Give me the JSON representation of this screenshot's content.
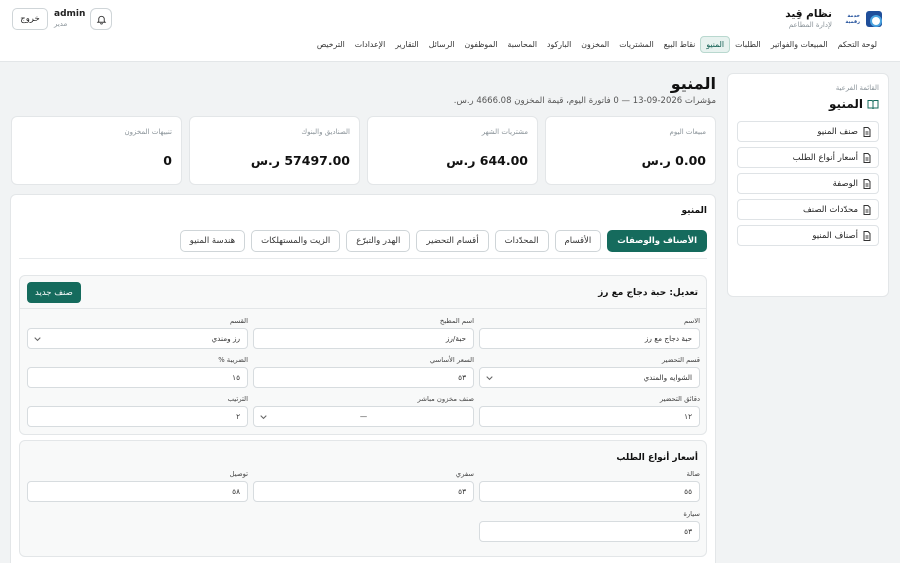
{
  "header": {
    "brand_name": "نظام قِيد",
    "brand_tagline": "لإدارة المطاعم",
    "brand_logo_text": "خدمة رقمية",
    "user_name": "admin",
    "user_role": "مدير",
    "logout_label": "خروج"
  },
  "nav": {
    "items": [
      "لوحة التحكم",
      "المبيعات والفواتير",
      "الطلبات",
      "المنيو",
      "نقاط البيع",
      "المشتريات",
      "المخزون",
      "الباركود",
      "المحاسبة",
      "الموظفون",
      "الرسائل",
      "التقارير",
      "الإعدادات",
      "الترخيص"
    ],
    "active_index": 3
  },
  "sidebar": {
    "label": "القائمة الفرعية",
    "title": "المنيو",
    "items": [
      "صنف المنيو",
      "أسعار أنواع الطلب",
      "الوصفة",
      "محدّدات الصنف",
      "أصناف المنيو"
    ]
  },
  "page": {
    "title": "المنيو",
    "subtitle": "مؤشرات 2026-09-13 — 0 فاتورة اليوم، قيمة المخزون 4666.08 ر.س."
  },
  "cards": [
    {
      "label": "مبيعات اليوم",
      "value": "0.00 ر.س"
    },
    {
      "label": "مشتريات الشهر",
      "value": "644.00 ر.س"
    },
    {
      "label": "الصناديق والبنوك",
      "value": "57497.00 ر.س"
    },
    {
      "label": "تنبيهات المخزون",
      "value": "0"
    }
  ],
  "panel": {
    "title": "المنيو",
    "tabs": [
      "الأصناف والوصفات",
      "الأقسام",
      "المحدّدات",
      "أقسام التحضير",
      "الهدر والتبرّع",
      "الزيت والمستهلكات",
      "هندسة المنيو"
    ],
    "active_tab": 0
  },
  "edit": {
    "title": "تعديل: حبة دجاج مع رز",
    "new_button": "صنف جديد",
    "fields": {
      "name": {
        "label": "الاسم",
        "value": "حبة دجاج مع رز"
      },
      "kitchen_name": {
        "label": "اسم المطبخ",
        "value": "حبة/رز"
      },
      "category": {
        "label": "القسم",
        "value": "رز ومندي"
      },
      "prep_section": {
        "label": "قسم التحضير",
        "value": "الشوايه والمندي"
      },
      "base_price": {
        "label": "السعر الأساسي",
        "value": "٥٣"
      },
      "tax": {
        "label": "الضريبة %",
        "value": "١٥"
      },
      "prep_minutes": {
        "label": "دقائق التحضير",
        "value": "١٢"
      },
      "direct_stock": {
        "label": "صنف مخزون مباشر",
        "value": "—"
      },
      "order": {
        "label": "الترتيب",
        "value": "٢"
      }
    }
  },
  "prices": {
    "title": "أسعار أنواع الطلب",
    "fields": {
      "hall": {
        "label": "صالة",
        "value": "٥٥"
      },
      "takeaway": {
        "label": "سفري",
        "value": "٥٣"
      },
      "delivery": {
        "label": "توصيل",
        "value": "٥٨"
      },
      "car": {
        "label": "سيارة",
        "value": "٥٣"
      }
    }
  }
}
